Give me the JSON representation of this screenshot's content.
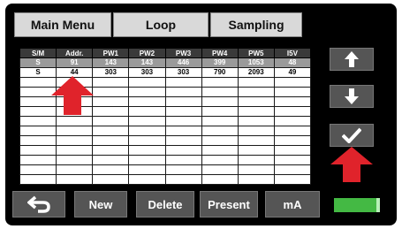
{
  "tabs": {
    "main_menu": "Main Menu",
    "loop": "Loop",
    "sampling": "Sampling"
  },
  "table": {
    "headers": [
      "S/M",
      "Addr.",
      "PW1",
      "PW2",
      "PW3",
      "PW4",
      "PW5",
      "I5V"
    ],
    "rows": [
      [
        "S",
        "91",
        "143",
        "143",
        "446",
        "399",
        "1053",
        "48"
      ],
      [
        "S",
        "44",
        "303",
        "303",
        "303",
        "790",
        "2093",
        "49"
      ],
      [
        "",
        "",
        "",
        "",
        "",
        "",
        "",
        ""
      ],
      [
        "",
        "",
        "",
        "",
        "",
        "",
        "",
        ""
      ],
      [
        "",
        "",
        "",
        "",
        "",
        "",
        "",
        ""
      ],
      [
        "",
        "",
        "",
        "",
        "",
        "",
        "",
        ""
      ],
      [
        "",
        "",
        "",
        "",
        "",
        "",
        "",
        ""
      ],
      [
        "",
        "",
        "",
        "",
        "",
        "",
        "",
        ""
      ],
      [
        "",
        "",
        "",
        "",
        "",
        "",
        "",
        ""
      ],
      [
        "",
        "",
        "",
        "",
        "",
        "",
        "",
        ""
      ],
      [
        "",
        "",
        "",
        "",
        "",
        "",
        "",
        ""
      ],
      [
        "",
        "",
        "",
        "",
        "",
        "",
        "",
        ""
      ],
      [
        "",
        "",
        "",
        "",
        "",
        "",
        "",
        ""
      ]
    ]
  },
  "side_buttons": {
    "up_icon": "arrow-up-icon",
    "down_icon": "arrow-down-icon",
    "ok_icon": "checkmark-icon"
  },
  "bottom_buttons": {
    "back_icon": "back-arrow-icon",
    "new": "New",
    "delete": "Delete",
    "present": "Present",
    "ma": "mA"
  },
  "colors": {
    "status_bar": "#44b944",
    "annotation_arrow": "#e0232b"
  }
}
